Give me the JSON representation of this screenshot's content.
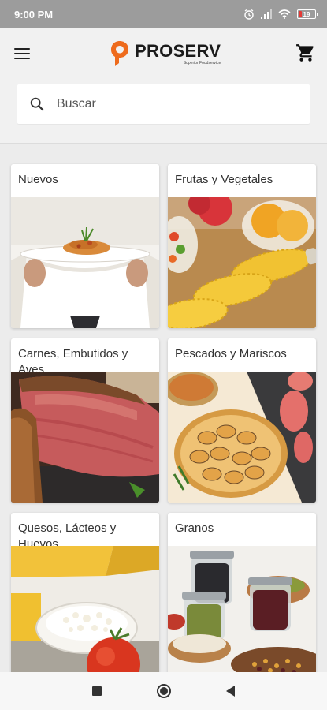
{
  "status_bar": {
    "time": "9:00 PM",
    "battery": "19",
    "battery_level": 0.19
  },
  "header": {
    "menu_icon": "hamburger-menu-icon",
    "logo_text": "PROSERV",
    "logo_tagline": "Superior Foodservice",
    "cart_icon": "shopping-cart-icon",
    "brand_color": "#ee6b1d"
  },
  "search": {
    "placeholder": "Buscar",
    "value": ""
  },
  "categories": [
    {
      "title": "Nuevos",
      "image": "plated-dish-photo"
    },
    {
      "title": "Frutas y Vegetales",
      "image": "corn-and-fruit-photo"
    },
    {
      "title": "Carnes, Embutidos y Aves",
      "image": "sliced-meat-photo"
    },
    {
      "title": "Pescados y Mariscos",
      "image": "clams-and-fish-photo"
    },
    {
      "title": "Quesos, Lácteos y Huevos",
      "image": "cheese-and-tomato-photo"
    },
    {
      "title": "Granos",
      "image": "grains-in-jars-photo"
    }
  ],
  "nav": {
    "recents_icon": "recents-square-icon",
    "home_icon": "home-circle-icon",
    "back_icon": "back-triangle-icon"
  }
}
